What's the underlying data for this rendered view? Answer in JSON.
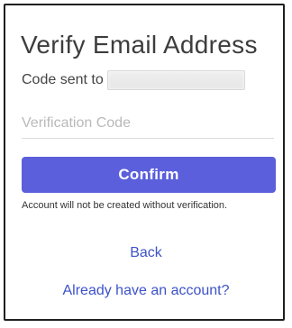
{
  "form": {
    "title": "Verify Email Address",
    "code_sent_label": "Code sent to",
    "code_placeholder": "Verification Code",
    "confirm_label": "Confirm",
    "note": "Account will not be created without verification.",
    "back_label": "Back",
    "login_link_label": "Already have an account?"
  },
  "colors": {
    "accent": "#5b5fdb",
    "link": "#3d52c9",
    "border": "#1f1f1f"
  }
}
